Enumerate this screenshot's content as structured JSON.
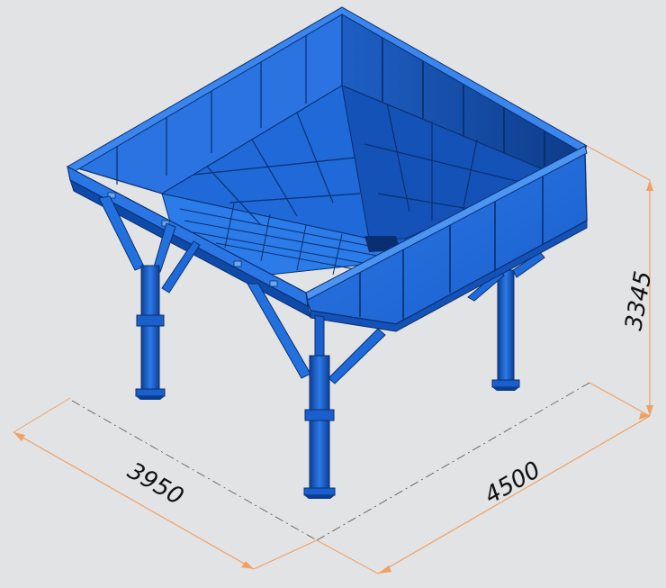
{
  "dimensions": {
    "width_label": "3950",
    "length_label": "4500",
    "height_label": "3345"
  },
  "colors": {
    "background": "#e2e3e5",
    "steel": "#1a64d6",
    "steel_dark": "#0b3d8f",
    "steel_shadow": "#0a2f70",
    "steel_light": "#3b86ee",
    "dimension_line": "#f0a060",
    "center_line": "#555555"
  }
}
